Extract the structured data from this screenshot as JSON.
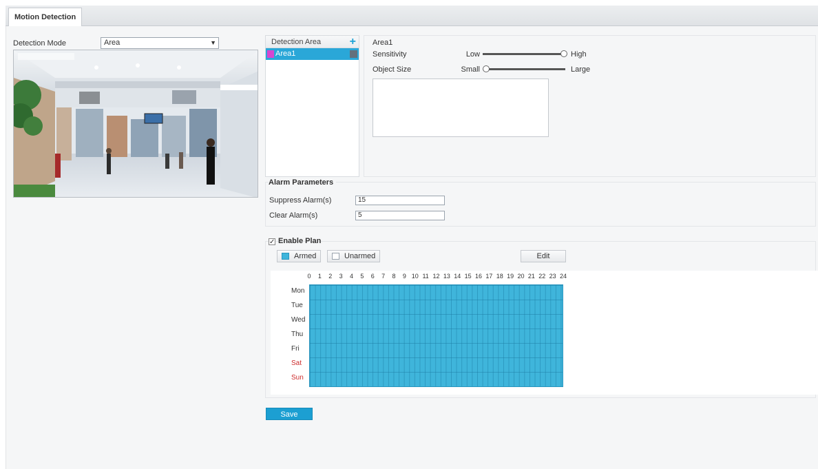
{
  "tabs": [
    {
      "label": "Motion Detection",
      "active": true
    }
  ],
  "detection_mode": {
    "label": "Detection Mode",
    "value": "Area"
  },
  "detection_area": {
    "header": "Detection Area",
    "items": [
      {
        "label": "Area1",
        "selected": true,
        "color": "#d646d0"
      }
    ]
  },
  "area_settings": {
    "title": "Area1",
    "sensitivity": {
      "label": "Sensitivity",
      "low": "Low",
      "high": "High",
      "value": 1.0
    },
    "object_size": {
      "label": "Object Size",
      "small": "Small",
      "large": "Large",
      "value": 0.0
    }
  },
  "alarm_parameters": {
    "title": "Alarm Parameters",
    "suppress": {
      "label": "Suppress Alarm(s)",
      "value": "15"
    },
    "clear": {
      "label": "Clear Alarm(s)",
      "value": "5"
    }
  },
  "plan": {
    "title": "Enable Plan",
    "enabled": true,
    "armed_label": "Armed",
    "unarmed_label": "Unarmed",
    "edit_label": "Edit",
    "hours": [
      "0",
      "1",
      "2",
      "3",
      "4",
      "5",
      "6",
      "7",
      "8",
      "9",
      "10",
      "11",
      "12",
      "13",
      "14",
      "15",
      "16",
      "17",
      "18",
      "19",
      "20",
      "21",
      "22",
      "23",
      "24"
    ],
    "days": [
      {
        "label": "Mon",
        "weekend": false
      },
      {
        "label": "Tue",
        "weekend": false
      },
      {
        "label": "Wed",
        "weekend": false
      },
      {
        "label": "Thu",
        "weekend": false
      },
      {
        "label": "Fri",
        "weekend": false
      },
      {
        "label": "Sat",
        "weekend": true
      },
      {
        "label": "Sun",
        "weekend": true
      }
    ],
    "armed_color": "#3fb5db",
    "unarmed_color": "#ffffff"
  },
  "save_label": "Save",
  "colors": {
    "accent": "#1c9fd2",
    "weekend": "#cc2a2a"
  }
}
